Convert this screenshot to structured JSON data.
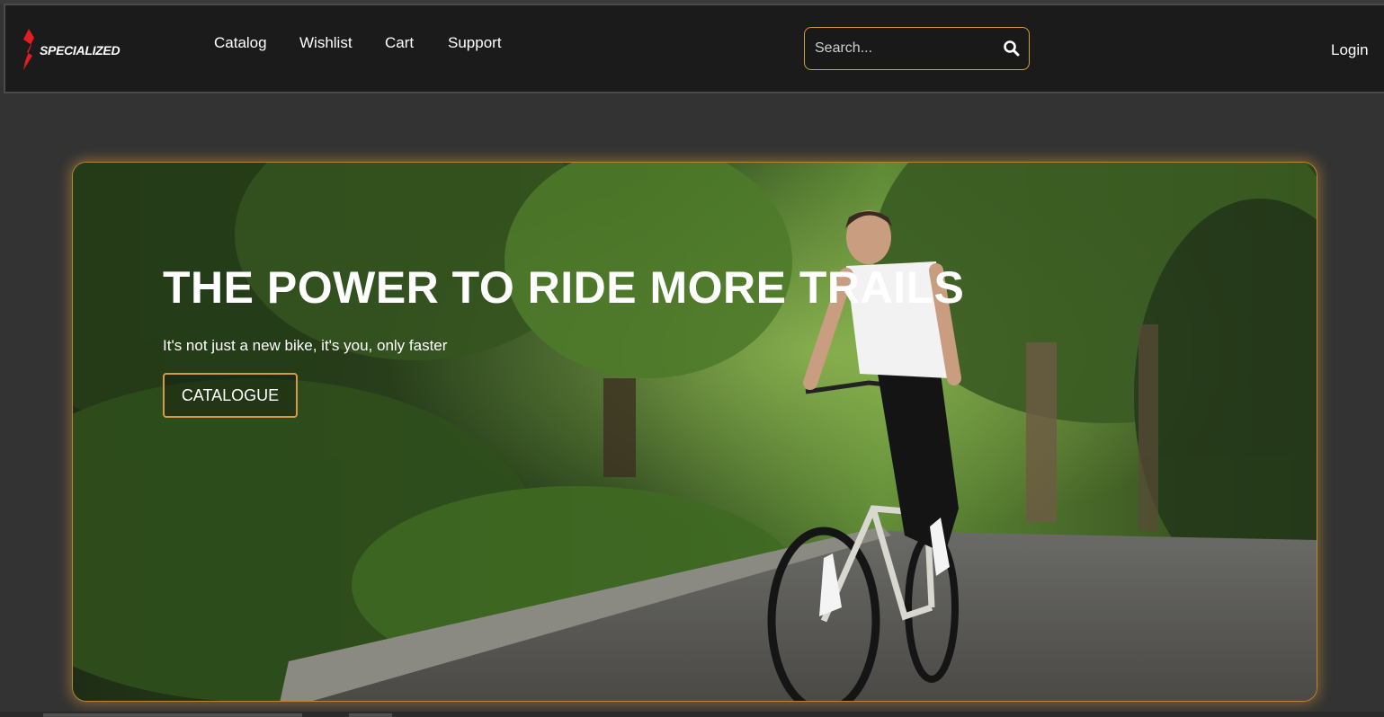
{
  "brand": {
    "name": "SPECIALIZED",
    "accent": "#d79a3f",
    "logo_red": "#e31b23"
  },
  "nav": {
    "links": [
      {
        "label": "Catalog"
      },
      {
        "label": "Wishlist"
      },
      {
        "label": "Cart"
      },
      {
        "label": "Support"
      }
    ],
    "login_label": "Login"
  },
  "search": {
    "placeholder": "Search...",
    "value": "",
    "icon": "search-icon"
  },
  "hero": {
    "title": "THE POWER TO RIDE MORE TRAILS",
    "subtitle": "It's not just a new bike, it's you, only faster",
    "button_label": "CATALOGUE"
  }
}
